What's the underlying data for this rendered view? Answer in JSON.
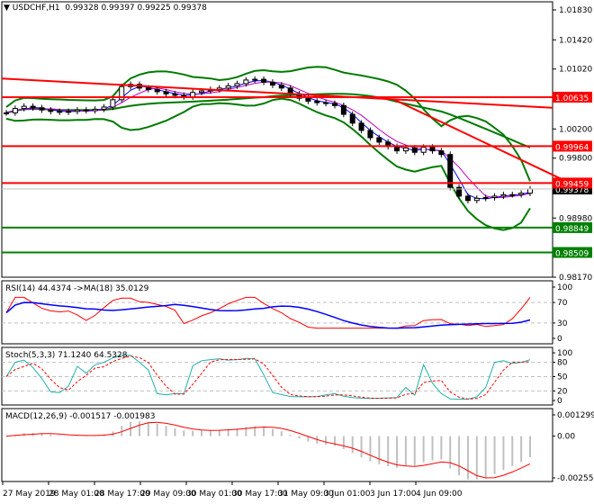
{
  "header": {
    "symbol": "USDCHF,H1",
    "ohlc": "0.99328 0.99397 0.99225 0.99378"
  },
  "colors": {
    "up": "#000000",
    "bb": "#007a00",
    "red": "#ff0000",
    "green": "#008000",
    "rsi": "#ff0000",
    "rsi_ma": "#0000ff",
    "stoch": "#20b2aa",
    "macd_hist": "#c0c0c0"
  },
  "chart_data": [
    {
      "type": "candlestick",
      "title": "USDCHF,H1",
      "ylim": [
        0.9817,
        1.0183
      ],
      "y_ticks": [
        "1.01830",
        "1.01420",
        "1.01020",
        "1.00200",
        "0.99800",
        "0.98980",
        "0.98170"
      ],
      "closes": [
        1.0042,
        1.0048,
        1.0051,
        1.0049,
        1.0046,
        1.0044,
        1.0043,
        1.0044,
        1.0046,
        1.0045,
        1.0047,
        1.005,
        1.006,
        1.0078,
        1.0081,
        1.0076,
        1.0074,
        1.0071,
        1.0068,
        1.0066,
        1.0064,
        1.007,
        1.0072,
        1.0074,
        1.0076,
        1.0079,
        1.0082,
        1.0087,
        1.0088,
        1.0084,
        1.008,
        1.0076,
        1.0068,
        1.0062,
        1.0058,
        1.0056,
        1.0055,
        1.0052,
        1.004,
        1.0028,
        1.0018,
        1.0008,
        1.0002,
        0.9996,
        0.999,
        0.9994,
        0.9988,
        0.9995,
        0.999,
        0.9985,
        0.994,
        0.9928,
        0.9922,
        0.9925,
        0.9926,
        0.9928,
        0.993,
        0.993,
        0.9932,
        0.99378
      ],
      "levels": [
        {
          "price": 1.00635,
          "label": "1.00635",
          "color": "#ff0000"
        },
        {
          "price": 0.99964,
          "label": "0.99964",
          "color": "#ff0000"
        },
        {
          "price": 0.99459,
          "label": "0.99459",
          "color": "#ff0000"
        },
        {
          "price": 0.98849,
          "label": "0.98849",
          "color": "#008000"
        },
        {
          "price": 0.98509,
          "label": "0.98509",
          "color": "#008000"
        }
      ],
      "current": {
        "price": 0.99378,
        "label": "0.99378"
      },
      "trendlines": [
        {
          "from": [
            0,
            1.0089
          ],
          "to": [
            1,
            1.0049
          ]
        },
        {
          "from": [
            0.71,
            1.0061
          ],
          "to": [
            1.02,
            0.995
          ]
        }
      ],
      "x_labels": [
        "27 May 2019",
        "28 May 01:00",
        "28 May 17:00",
        "29 May 09:00",
        "30 May 01:00",
        "30 May 17:00",
        "31 May 09:00",
        "3 Jun 01:00",
        "3 Jun 17:00",
        "4 Jun 09:00"
      ]
    },
    {
      "type": "line",
      "title": "RSI(14) 44.4374  ->MA(18) 35.0129",
      "ylim": [
        0,
        100
      ],
      "y_ticks": [
        "100",
        "70",
        "30",
        "0"
      ]
    },
    {
      "type": "line",
      "title": "Stoch(5,3,3) 71.1240 64.5328",
      "ylim": [
        0,
        100
      ],
      "y_ticks": [
        "100",
        "80",
        "50",
        "20",
        "0"
      ]
    },
    {
      "type": "bar",
      "title": "MACD(12,26,9) -0.001517 -0.001983",
      "ylim": [
        -0.002556,
        0.001299
      ],
      "y_ticks": [
        "0.001299",
        "0.00",
        "-0.002556"
      ]
    }
  ]
}
